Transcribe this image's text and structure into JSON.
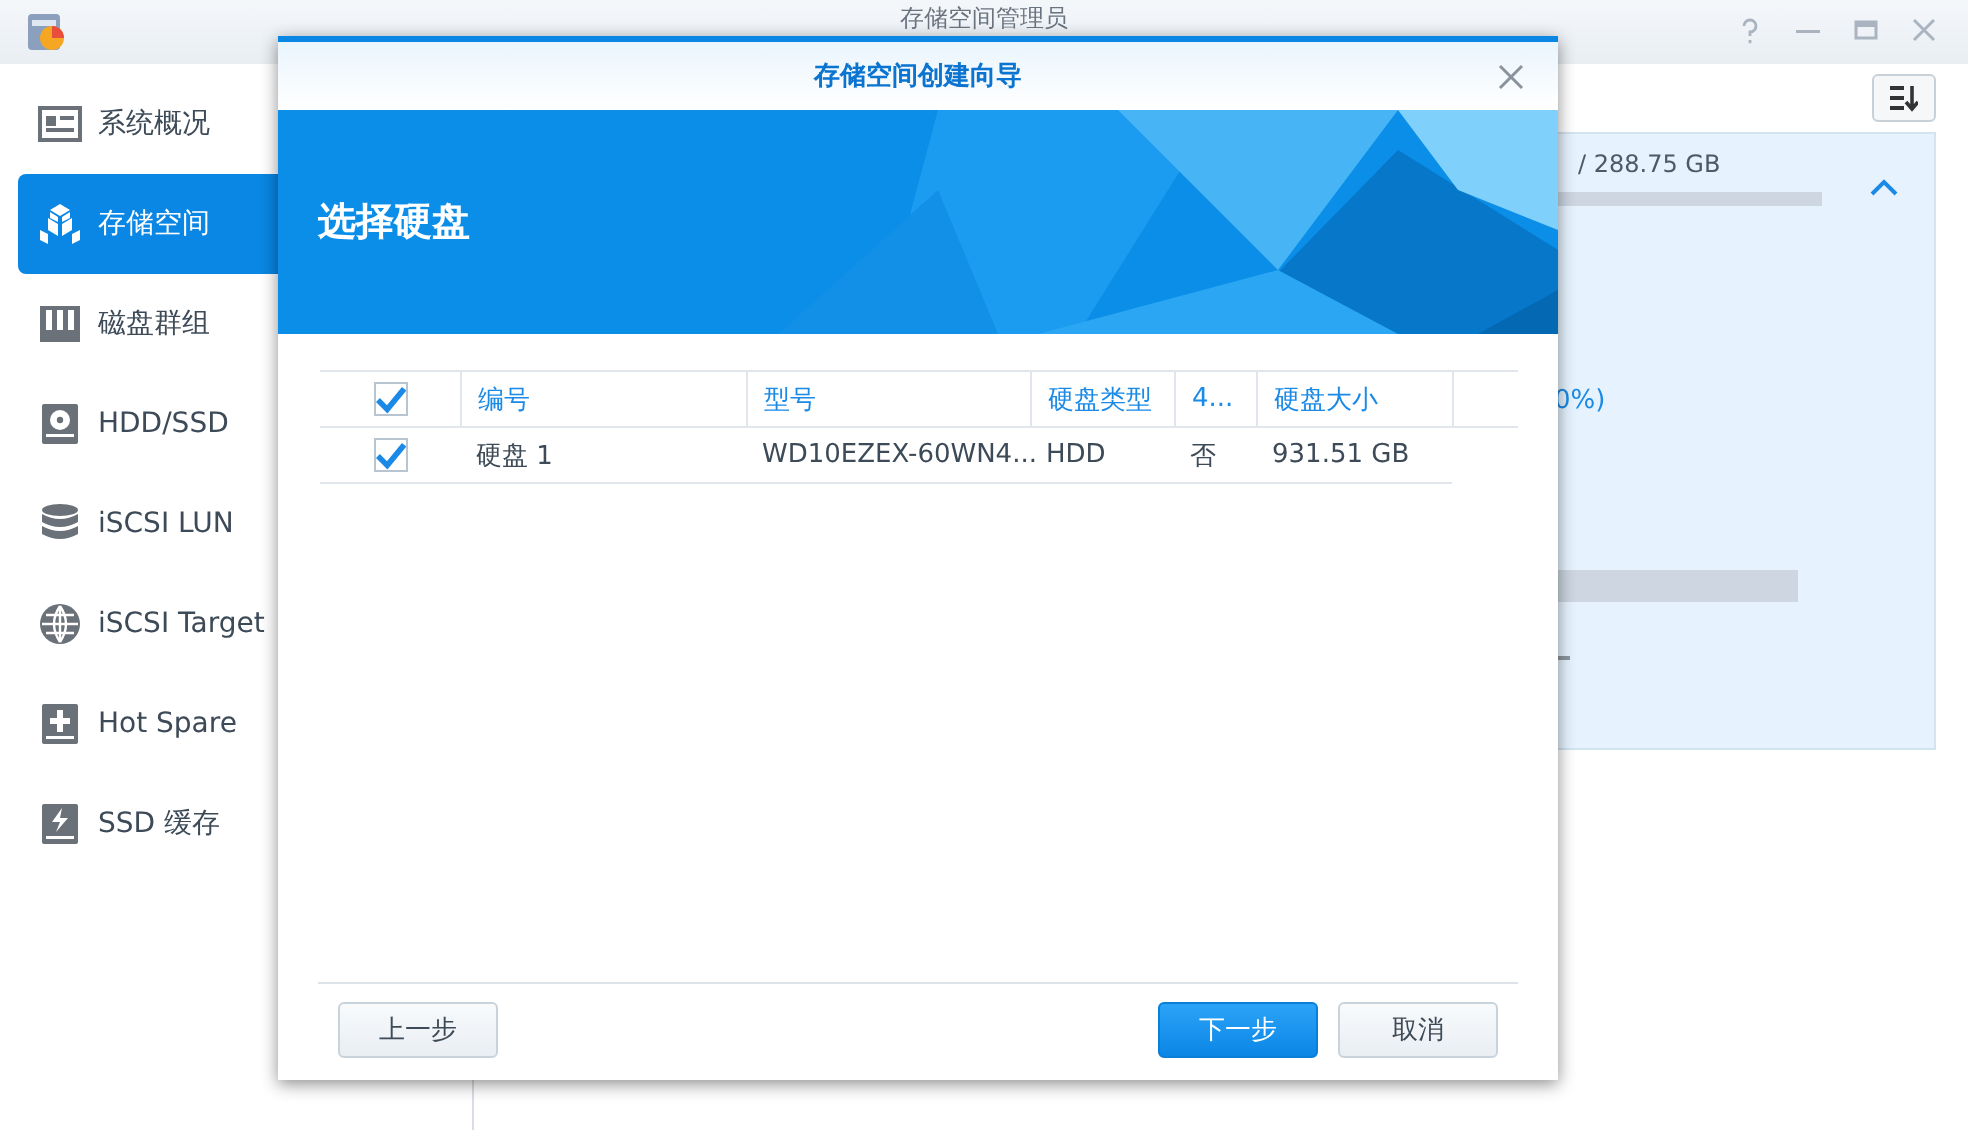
{
  "window": {
    "title": "存储空间管理员"
  },
  "sidebar": {
    "items": [
      {
        "label": "系统概况",
        "kind": "overview",
        "selected": false
      },
      {
        "label": "存储空间",
        "kind": "volume",
        "selected": true
      },
      {
        "label": "磁盘群组",
        "kind": "group",
        "selected": false
      },
      {
        "label": "HDD/SSD",
        "kind": "disk",
        "selected": false
      },
      {
        "label": "iSCSI LUN",
        "kind": "lun",
        "selected": false
      },
      {
        "label": "iSCSI Target",
        "kind": "target",
        "selected": false
      },
      {
        "label": "Hot Spare",
        "kind": "spare",
        "selected": false
      },
      {
        "label": "SSD 缓存",
        "kind": "cache",
        "selected": false
      }
    ]
  },
  "panel": {
    "capacity": "/ 288.75 GB",
    "percent": "0%)",
    "expanded": true
  },
  "dialog": {
    "title": "存储空间创建向导",
    "heading": "选择硬盘",
    "table": {
      "select_all": true,
      "columns": [
        "编号",
        "型号",
        "硬盘类型",
        "4...",
        "硬盘大小"
      ],
      "rows": [
        {
          "checked": true,
          "cells": [
            "硬盘 1",
            "WD10EZEX-60WN4...",
            "HDD",
            "否",
            "931.51 GB"
          ]
        }
      ]
    },
    "buttons": [
      {
        "label": "上一步",
        "kind": "secondary"
      },
      {
        "label": "下一步",
        "kind": "primary"
      },
      {
        "label": "取消",
        "kind": "secondary"
      }
    ]
  }
}
